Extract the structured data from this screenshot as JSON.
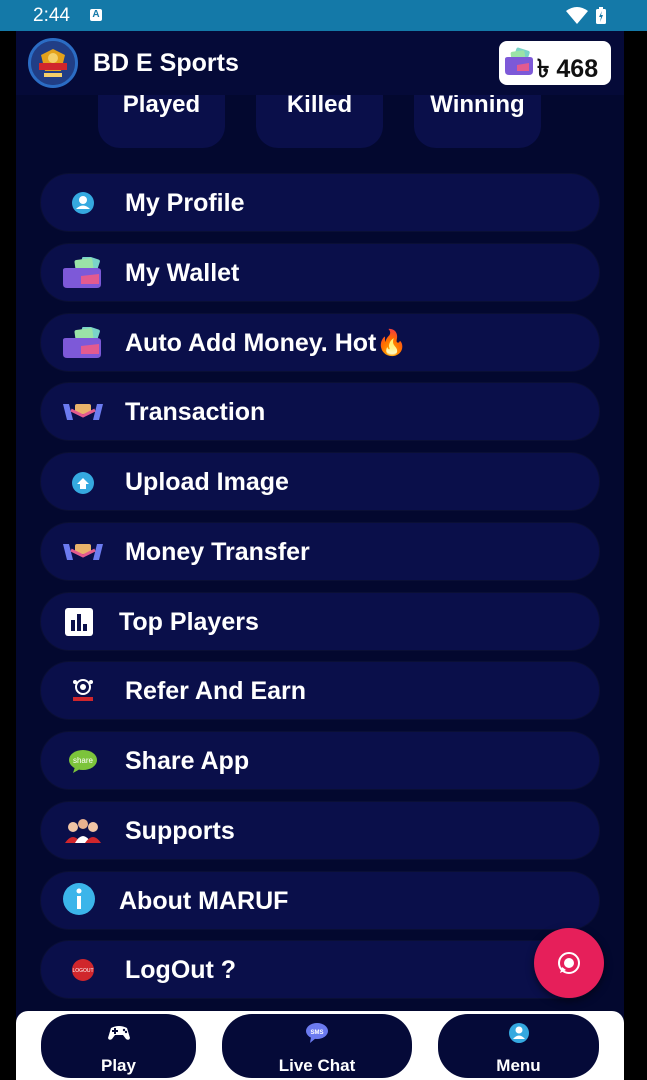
{
  "status_bar": {
    "time": "2:44",
    "notification_badge": "A"
  },
  "app_bar": {
    "title": "BD E Sports",
    "balance": "৳ 468",
    "logo_icon": "esports-logo-icon"
  },
  "stats": [
    "Played",
    "Killed",
    "Winning"
  ],
  "menu": [
    {
      "label": "My Profile",
      "icon": "profile-icon"
    },
    {
      "label": "My Wallet",
      "icon": "wallet-icon"
    },
    {
      "label": "Auto Add Money. Hot🔥",
      "icon": "wallet-icon"
    },
    {
      "label": "Transaction",
      "icon": "transaction-icon"
    },
    {
      "label": "Upload Image",
      "icon": "upload-icon"
    },
    {
      "label": "Money Transfer",
      "icon": "money-transfer-icon"
    },
    {
      "label": "Top Players",
      "icon": "bar-chart-icon"
    },
    {
      "label": "Refer And Earn",
      "icon": "refer-icon"
    },
    {
      "label": "Share App",
      "icon": "share-icon"
    },
    {
      "label": "Supports",
      "icon": "support-icon"
    },
    {
      "label": "About MARUF",
      "icon": "info-icon"
    },
    {
      "label": "LogOut ?",
      "icon": "logout-icon"
    }
  ],
  "bottom_nav": [
    {
      "label": "Play",
      "icon": "gamepad-icon"
    },
    {
      "label": "Live Chat",
      "icon": "sms-chat-icon"
    },
    {
      "label": "Menu",
      "icon": "menu-user-icon"
    }
  ],
  "chat_icon_text": "SMS",
  "logout_icon_text": "LOGOUT",
  "share_icon_text": "share",
  "colors": {
    "status_bar": "#1479a8",
    "background": "#03082f",
    "card": "#0a0f4a",
    "fab": "#e61f5a",
    "whatsapp": "#25d366"
  }
}
